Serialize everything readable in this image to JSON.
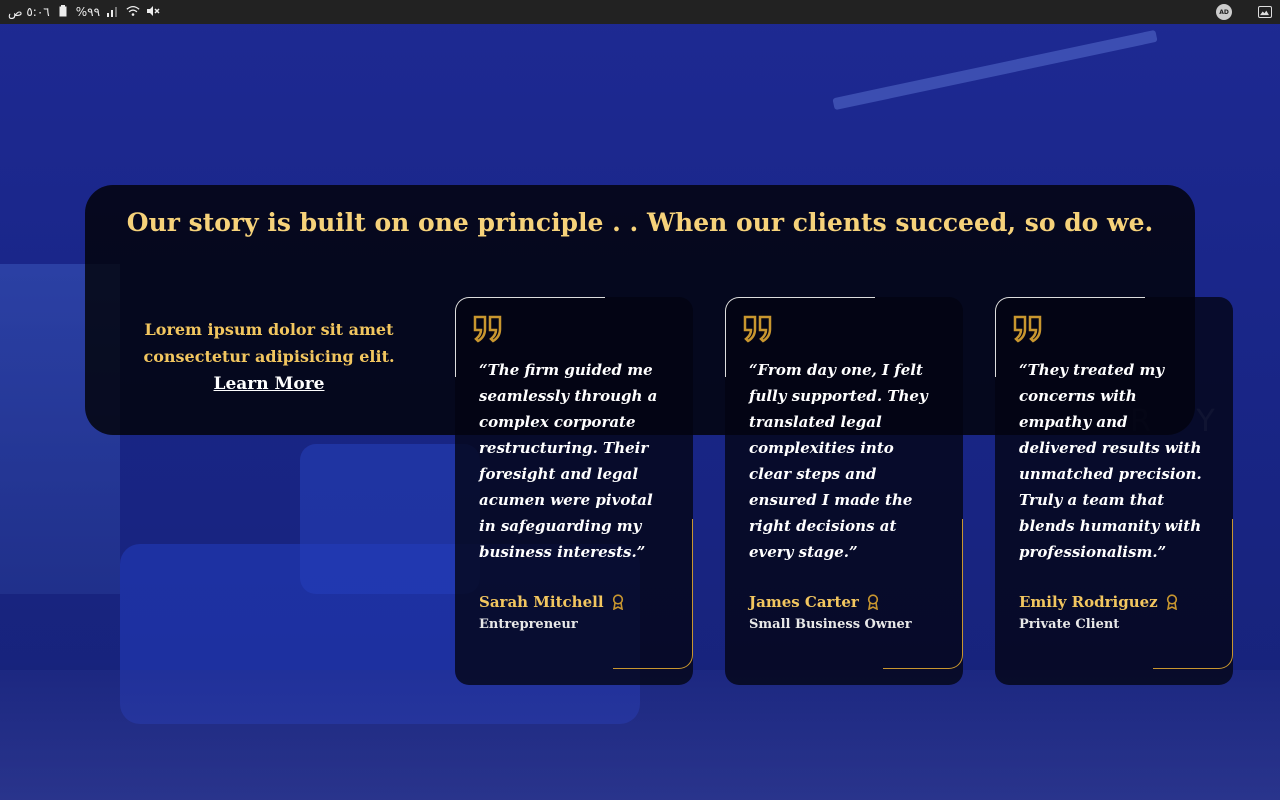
{
  "status_bar": {
    "time": "٥:٠٦ ص",
    "battery": "%٩٩",
    "right_icons": [
      "ad-icon",
      "image-icon"
    ]
  },
  "section": {
    "headline": "Our story is built on one principle . . When our clients succeed, so do we.",
    "intro": "Lorem ipsum dolor sit amet consectetur adipisicing elit.",
    "learn_more": "Learn More"
  },
  "background_letters": "R Y",
  "testimonials": [
    {
      "quote": "“The firm guided me seamlessly through a complex corporate restructuring. Their foresight and legal acumen were pivotal in safeguarding my business interests.”",
      "name": "Sarah Mitchell",
      "role": "Entrepreneur"
    },
    {
      "quote": "“From day one, I felt fully supported. They translated legal complexities into clear steps and ensured I made the right decisions at every stage.”",
      "name": "James Carter",
      "role": "Small Business Owner"
    },
    {
      "quote": "“They treated my concerns with empathy and delivered results with unmatched precision. Truly a team that blends humanity with professionalism.”",
      "name": "Emily Rodriguez",
      "role": "Private Client"
    }
  ],
  "colors": {
    "accent_gold": "#f2c65f",
    "headline_gold": "#f6d27a",
    "quote_icon": "#c8962f",
    "background_blue": "#1c2a8a"
  }
}
